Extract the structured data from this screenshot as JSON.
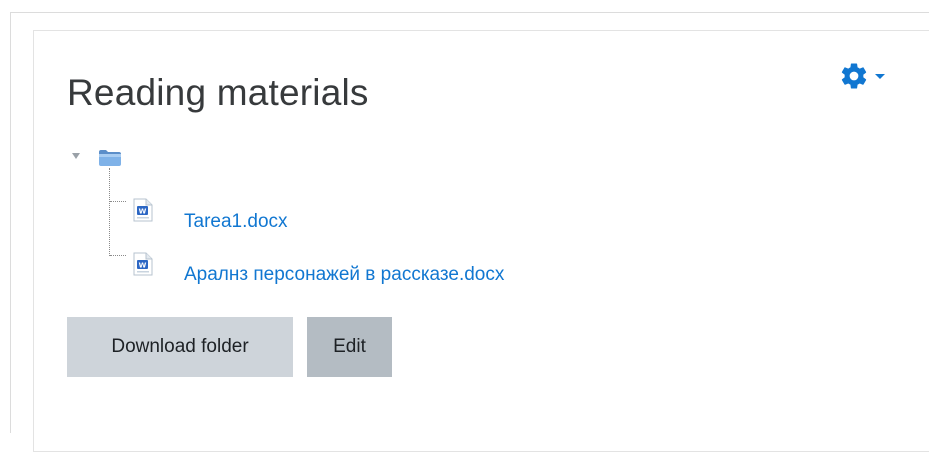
{
  "section": {
    "title": "Reading materials"
  },
  "actions_menu": {
    "icon": "gear-icon",
    "caret_icon": "caret-down-icon",
    "accent": "#1177d1"
  },
  "folder_tree": {
    "root_icon": "folder-icon",
    "files": [
      {
        "name": "Tarea1.docx",
        "icon": "word-document-icon"
      },
      {
        "name": "Аралнз персонажей в рассказе.docx",
        "icon": "word-document-icon"
      }
    ]
  },
  "buttons": {
    "download_label": "Download folder",
    "edit_label": "Edit"
  },
  "colors": {
    "link": "#1177d1",
    "button_secondary": "#ced4da",
    "button_secondary_hover": "#b4bcc3"
  }
}
